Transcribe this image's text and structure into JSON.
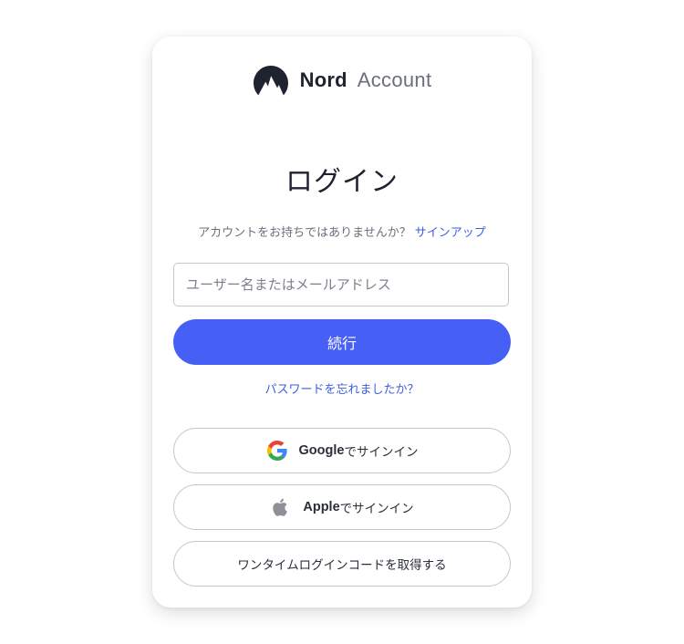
{
  "brand": {
    "name": "Nord",
    "product": "Account",
    "icon": "nord-mountain-logo"
  },
  "login": {
    "title": "ログイン",
    "no_account_text": "アカウントをお持ちではありませんか？",
    "signup_link": "サインアップ",
    "username_placeholder": "ユーザー名またはメールアドレス",
    "continue_label": "続行",
    "forgot_password": "パスワードを忘れましたか？"
  },
  "social": {
    "google": {
      "brand": "Google",
      "suffix": "でサインイン",
      "icon": "google-icon"
    },
    "apple": {
      "brand": "Apple",
      "suffix": "でサインイン",
      "icon": "apple-icon"
    },
    "otp_label": "ワンタイムログインコードを取得する"
  },
  "colors": {
    "primary": "#4660f6",
    "link": "#3e5fe0",
    "text": "#1f2330",
    "muted": "#6b6f7b",
    "border": "#c4c7cf"
  }
}
